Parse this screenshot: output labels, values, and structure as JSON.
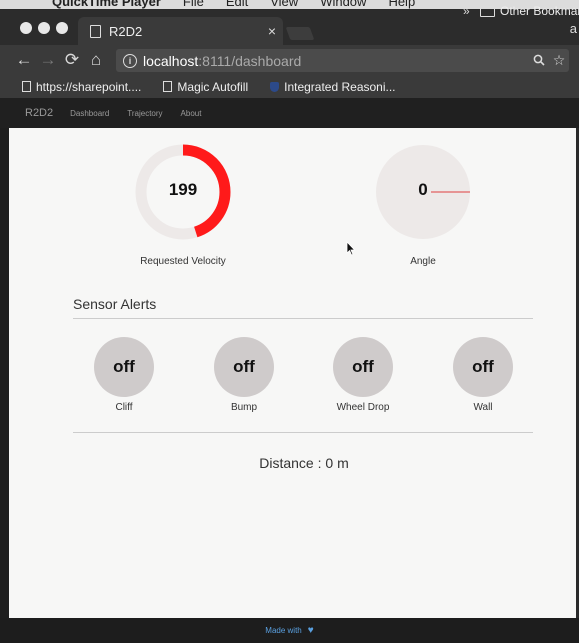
{
  "menubar": {
    "app": "QuickTime Player",
    "items": [
      "File",
      "Edit",
      "View",
      "Window",
      "Help"
    ]
  },
  "tab": {
    "title": "R2D2",
    "close": "×"
  },
  "toolbar": {
    "url_host": "localhost",
    "url_path": ":8111/dashboard",
    "back": "←",
    "forward": "→",
    "reload": "⟳",
    "home": "⌂",
    "zoom_icon": "🔍",
    "star_icon": "☆"
  },
  "bookmarks": {
    "items": [
      "https://sharepoint....",
      "Magic Autofill",
      "Integrated Reasoni..."
    ],
    "more": "»",
    "other": "Other Bookmar"
  },
  "appnav": {
    "brand": "R2D2",
    "links": [
      "Dashboard",
      "Trajectory",
      "About"
    ]
  },
  "gauges": [
    {
      "label": "Requested Velocity",
      "value": "199",
      "fill_fraction": 0.45,
      "color": "#ff1a1a"
    },
    {
      "label": "Angle",
      "value": "0",
      "color": "#e04040"
    }
  ],
  "sensors": {
    "title": "Sensor Alerts",
    "items": [
      {
        "label": "Cliff",
        "state": "off"
      },
      {
        "label": "Bump",
        "state": "off"
      },
      {
        "label": "Wheel Drop",
        "state": "off"
      },
      {
        "label": "Wall",
        "state": "off"
      }
    ]
  },
  "distance": "Distance : 0 m",
  "footer": {
    "text": "Made with",
    "icon": "♥"
  }
}
